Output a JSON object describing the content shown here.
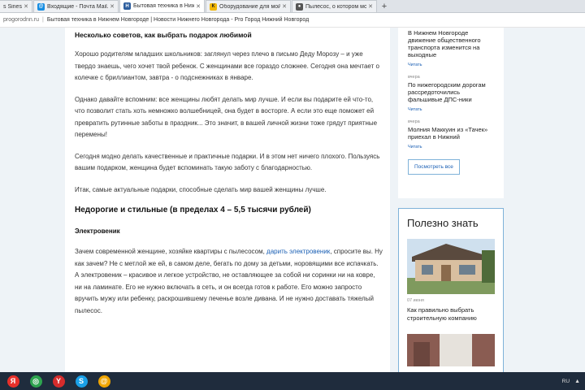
{
  "browser": {
    "tabs": [
      {
        "label": "s Sineshko",
        "favicon_color": "#6b8fb8",
        "favicon_char": ""
      },
      {
        "label": "Входящие - Почта Mail.Ru",
        "favicon_color": "#168de2",
        "favicon_char": "@"
      },
      {
        "label": "Бытовая техника в Нижн",
        "favicon_color": "#2d5e9e",
        "favicon_char": "Н",
        "active": true
      },
      {
        "label": "Оборудование для мой",
        "favicon_color": "#f2b705",
        "favicon_char": "К"
      },
      {
        "label": "Пылесос, о котором мо",
        "favicon_color": "#555555",
        "favicon_char": "●"
      }
    ],
    "new_tab_symbol": "+",
    "bookmarks": [
      "progorodnn.ru",
      "Бытовая техника в Нижнем Новгороде | Новости Нижнего Новгорода - Pro Город Нижний Новгород"
    ]
  },
  "article": {
    "heading_tips": "Несколько советов, как выбрать подарок любимой",
    "p1": "Хорошо родителям младших школьников: заглянул через плечо в письмо Деду Морозу – и уже твердо знаешь, чего хочет твой ребенок. С женщинами все гораздо сложнее. Сегодня она мечтает о колечке с бриллиантом, завтра - о подснежниках в январе.",
    "p2": "Однако давайте вспомним: все женщины любят делать мир лучше. И если вы подарите ей что-то, что позволит стать хоть немножко волшебницей, она будет в восторге. А если это еще поможет ей превратить рутинные заботы в праздник... Это значит, в вашей личной жизни тоже грядут приятные перемены!",
    "p3": "Сегодня модно делать качественные и практичные подарки. И в этом нет ничего плохого. Пользуясь вашим подарком, женщина будет вспоминать такую заботу с благодарностью.",
    "p4": "Итак, самые актуальные подарки, способные сделать мир вашей женщины лучше.",
    "section_title": "Недорогие и стильные (в пределах 4 – 5,5 тысячи рублей)",
    "subsection_title": "Электровеник",
    "p5_before": "Зачем современной женщине, хозяйке квартиры с пылесосом, ",
    "p5_link": "дарить электровеник",
    "p5_after": ", спросите вы. Ну как зачем? Не с метлой же ей, в самом деле, бегать по дому за детьми, норовящими все испачкать. А электровеник – красивое и легкое устройство, не оставляющее за собой ни соринки ни на ковре, ни на ламинате. Его не нужно включать в сеть, и он всегда готов к работе. Его можно запросто вручить мужу или ребенку, раскрошившему печенье возле дивана. И не нужно доставать тяжелый пылесос."
  },
  "sidebar": {
    "news": [
      {
        "date": "",
        "title": "В Нижнем Новгороде движение общественного транспорта изменится на выходные",
        "read": "Читать"
      },
      {
        "date": "вчера",
        "title": "По нижегородским дорогам рассредоточились фальшивые ДПС-ники",
        "read": "Читать"
      },
      {
        "date": "вчера",
        "title": "Молния Маккуин из «Тачек» приехал в Нижний",
        "read": "Читать"
      }
    ],
    "more_button": "Посмотреть все",
    "useful_title": "Полезно знать",
    "useful_date": "07 июня",
    "useful_article": "Как правильно выбрать строительную компанию"
  },
  "taskbar": {
    "icons": [
      {
        "name": "yandex-icon",
        "color": "#e8302a",
        "char": "Я"
      },
      {
        "name": "chrome-icon",
        "color": "#2ea44f",
        "char": "◎"
      },
      {
        "name": "yandex-browser-icon",
        "color": "#d62c2c",
        "char": "Y"
      },
      {
        "name": "skype-icon",
        "color": "#1aa0e8",
        "char": "S"
      },
      {
        "name": "mail-agent-icon",
        "color": "#f0a500",
        "char": "@"
      }
    ],
    "lang": "RU"
  }
}
